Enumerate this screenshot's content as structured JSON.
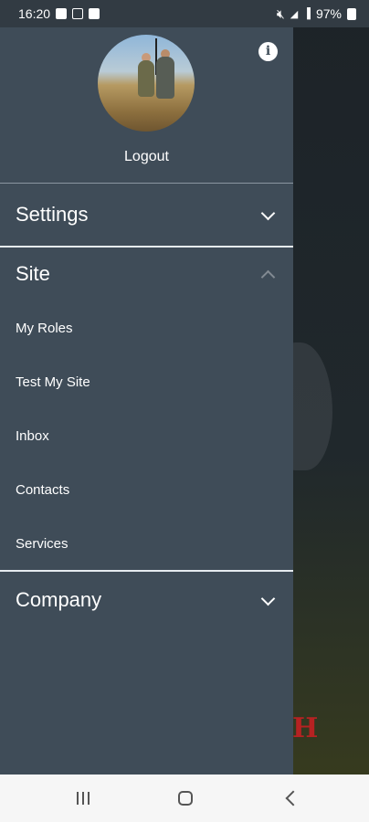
{
  "status_bar": {
    "time": "16:20",
    "battery": "97%"
  },
  "profile": {
    "logout_label": "Logout"
  },
  "sections": {
    "settings": {
      "label": "Settings"
    },
    "site": {
      "label": "Site",
      "items": [
        "My Roles",
        "Test My Site",
        "Inbox",
        "Contacts",
        "Services"
      ]
    },
    "company": {
      "label": "Company"
    }
  },
  "colors": {
    "drawer_bg": "#3f4c58",
    "status_bar_bg": "#323b43"
  }
}
